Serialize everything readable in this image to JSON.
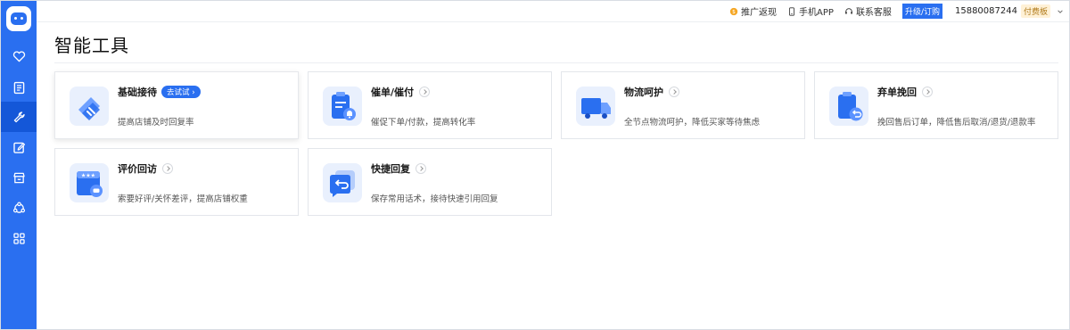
{
  "topbar": {
    "promo_label": "推广返现",
    "app_label": "手机APP",
    "support_label": "联系客服",
    "upgrade_label": "升级/订购",
    "phone": "15880087244",
    "plan_badge": "付费板"
  },
  "page": {
    "title": "智能工具"
  },
  "sidebar": {
    "items": [
      {
        "icon": "heart-icon"
      },
      {
        "icon": "document-icon"
      },
      {
        "icon": "wrench-icon",
        "active": true
      },
      {
        "icon": "edit-icon"
      },
      {
        "icon": "store-icon"
      },
      {
        "icon": "share-network-icon"
      },
      {
        "icon": "grid-icon"
      }
    ]
  },
  "cards": [
    {
      "title": "基础接待",
      "badge": "去试试",
      "desc": "提高店铺及时回复率"
    },
    {
      "title": "催单/催付",
      "desc": "催促下单/付款，提高转化率"
    },
    {
      "title": "物流呵护",
      "desc": "全节点物流呵护，降低买家等待焦虑"
    },
    {
      "title": "弃单挽回",
      "desc": "挽回售后订单，降低售后取消/退货/退款率"
    },
    {
      "title": "评价回访",
      "desc": "索要好评/关怀差评，提高店铺权重"
    },
    {
      "title": "快捷回复",
      "desc": "保存常用话术，接待快速引用回复"
    }
  ],
  "colors": {
    "accent": "#2a6ff0",
    "icon_tile_bg": "#e9f0fd"
  }
}
